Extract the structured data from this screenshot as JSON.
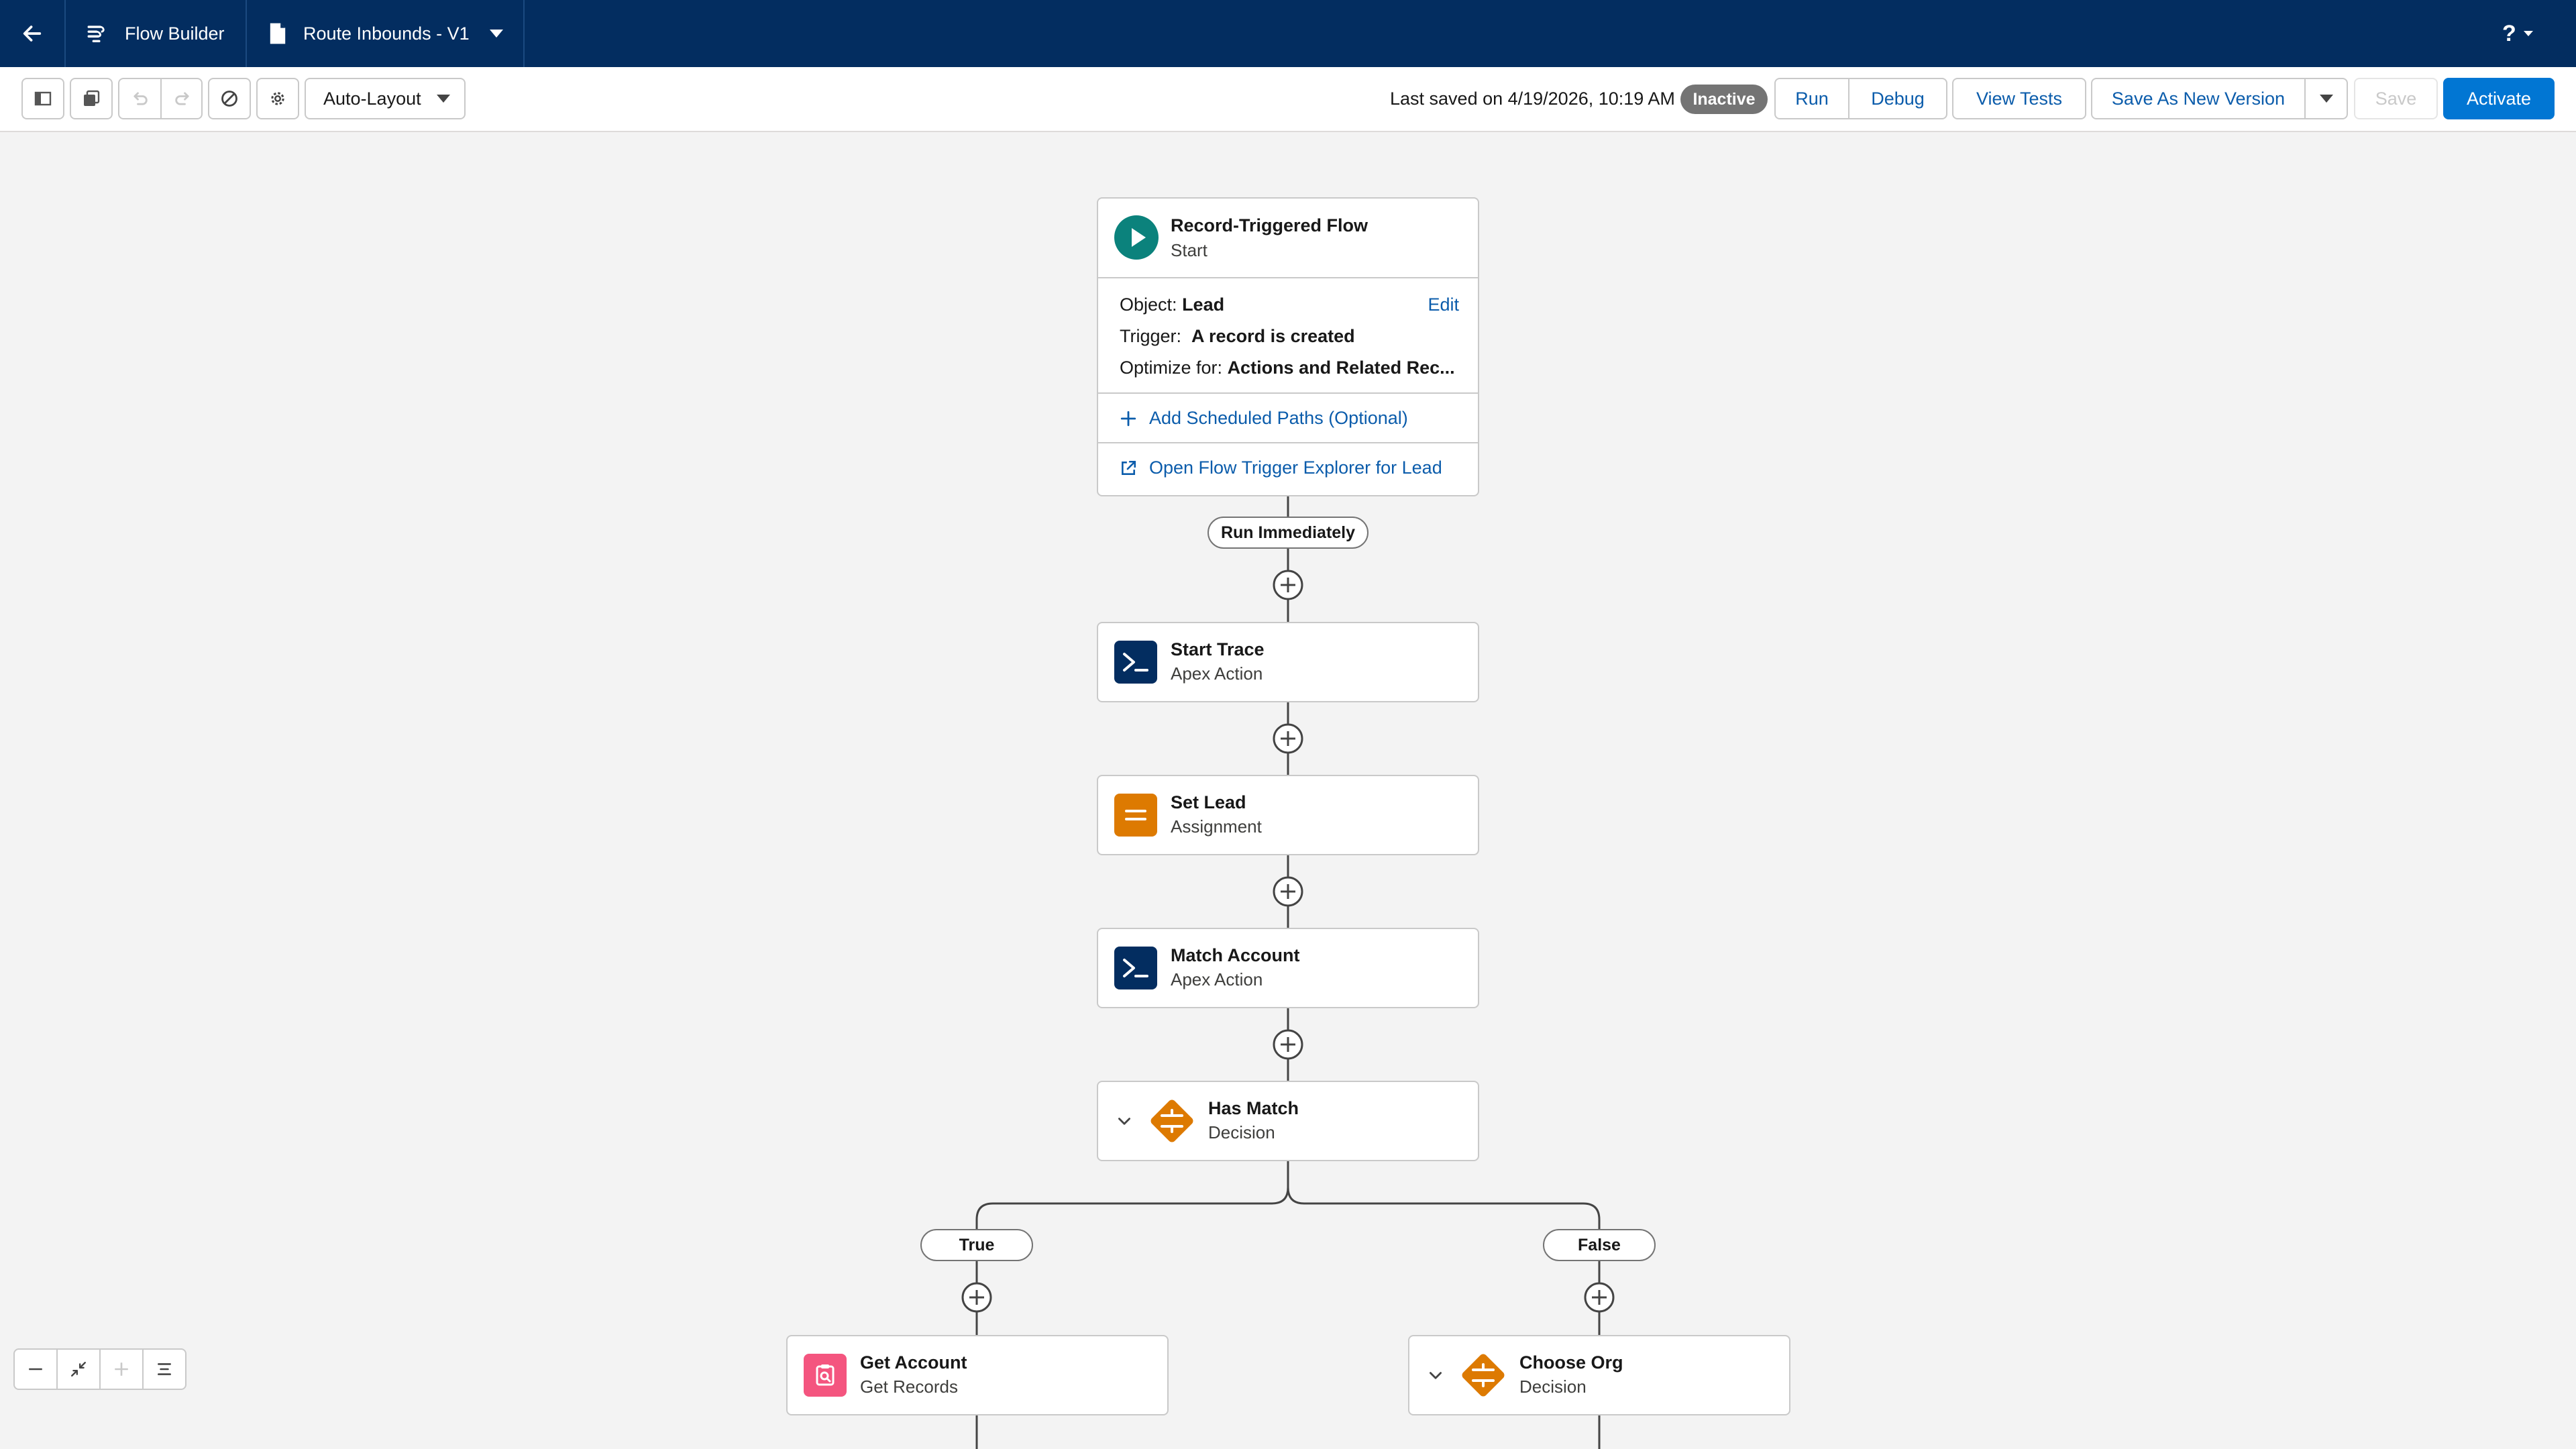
{
  "topbar": {
    "back_icon": "back-arrow-icon",
    "app_name": "Flow Builder",
    "flow_name": "Route Inbounds - V1",
    "help_label": "?"
  },
  "toolbar": {
    "layout_select": "Auto-Layout",
    "last_saved": "Last saved on 4/19/2026, 10:19 AM",
    "status_badge": "Inactive",
    "run": "Run",
    "debug": "Debug",
    "view_tests": "View Tests",
    "save_as_new_version": "Save As New Version",
    "save": "Save",
    "activate": "Activate"
  },
  "start_node": {
    "title": "Record-Triggered Flow",
    "subtitle": "Start",
    "object_label": "Object:",
    "object_value": "Lead",
    "edit": "Edit",
    "trigger_label": "Trigger:",
    "trigger_value": "A record is created",
    "optimize_label": "Optimize for:",
    "optimize_value": "Actions and Related Rec...",
    "add_scheduled_paths": "Add Scheduled Paths (Optional)",
    "open_trigger_explorer": "Open Flow Trigger Explorer for Lead"
  },
  "connector_labels": {
    "run_immediately": "Run Immediately",
    "true": "True",
    "false": "False"
  },
  "nodes": [
    {
      "title": "Start Trace",
      "subtitle": "Apex Action"
    },
    {
      "title": "Set Lead",
      "subtitle": "Assignment"
    },
    {
      "title": "Match Account",
      "subtitle": "Apex Action"
    },
    {
      "title": "Has Match",
      "subtitle": "Decision"
    },
    {
      "title": "Get Account",
      "subtitle": "Get Records"
    },
    {
      "title": "Choose Org",
      "subtitle": "Decision"
    }
  ],
  "colors": {
    "header_bg": "#032d60",
    "brand_blue": "#0176d3",
    "link_blue": "#0b5cab",
    "apex_icon": "#032d60",
    "assignment_icon": "#dd7a01",
    "decision_icon": "#dd7a01",
    "get_records_icon": "#f4557f",
    "start_icon": "#0b827c",
    "inactive_badge": "#747474"
  }
}
